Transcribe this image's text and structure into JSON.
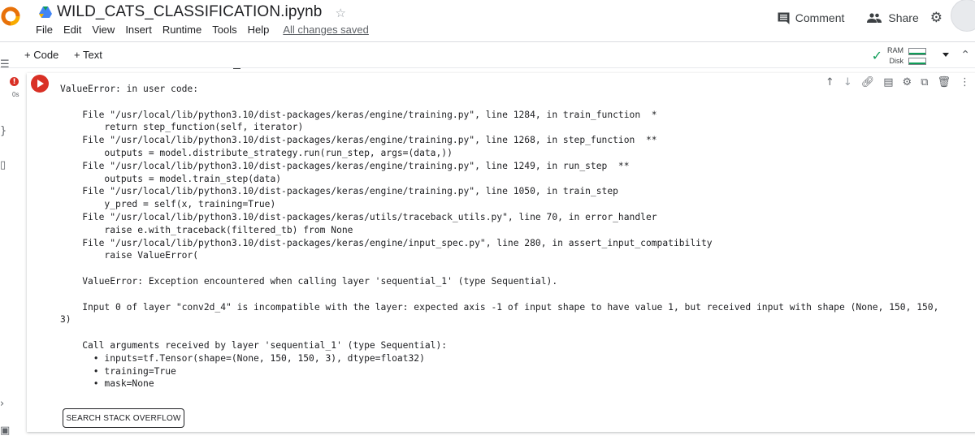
{
  "header": {
    "doc_title": "WILD_CATS_CLASSIFICATION.ipynb",
    "menu": [
      "File",
      "Edit",
      "View",
      "Insert",
      "Runtime",
      "Tools",
      "Help"
    ],
    "save_status": "All changes saved",
    "comment_label": "Comment",
    "share_label": "Share",
    "brand_color": "#f9ab00"
  },
  "toolbar": {
    "add_code_label": "+ Code",
    "add_text_label": "+ Text",
    "ram_label": "RAM",
    "disk_label": "Disk"
  },
  "cell": {
    "exec_time": "0s",
    "status": "error",
    "error_color": "#d93025",
    "output_lines": [
      "ValueError: in user code:",
      "",
      "    File \"/usr/local/lib/python3.10/dist-packages/keras/engine/training.py\", line 1284, in train_function  *",
      "        return step_function(self, iterator)",
      "    File \"/usr/local/lib/python3.10/dist-packages/keras/engine/training.py\", line 1268, in step_function  **",
      "        outputs = model.distribute_strategy.run(run_step, args=(data,))",
      "    File \"/usr/local/lib/python3.10/dist-packages/keras/engine/training.py\", line 1249, in run_step  **",
      "        outputs = model.train_step(data)",
      "    File \"/usr/local/lib/python3.10/dist-packages/keras/engine/training.py\", line 1050, in train_step",
      "        y_pred = self(x, training=True)",
      "    File \"/usr/local/lib/python3.10/dist-packages/keras/utils/traceback_utils.py\", line 70, in error_handler",
      "        raise e.with_traceback(filtered_tb) from None",
      "    File \"/usr/local/lib/python3.10/dist-packages/keras/engine/input_spec.py\", line 280, in assert_input_compatibility",
      "        raise ValueError(",
      "",
      "    ValueError: Exception encountered when calling layer 'sequential_1' (type Sequential).",
      "",
      "    Input 0 of layer \"conv2d_4\" is incompatible with the layer: expected axis -1 of input shape to have value 1, but received input with shape (None, 150, 150,",
      "3)",
      "",
      "    Call arguments received by layer 'sequential_1' (type Sequential):",
      "      • inputs=tf.Tensor(shape=(None, 150, 150, 3), dtype=float32)",
      "      • training=True",
      "      • mask=None"
    ],
    "search_button_label": "SEARCH STACK OVERFLOW"
  },
  "icons": {
    "logo": "colab-logo-icon",
    "drive": "drive-icon",
    "star": "star-icon",
    "comment": "comment-icon",
    "share": "people-icon",
    "settings": "gear-icon",
    "cell_tools": [
      "arrow-up-icon",
      "arrow-down-icon",
      "link-icon",
      "comment-icon",
      "gear-icon",
      "mirror-cell-icon",
      "delete-icon",
      "more-vert-icon"
    ]
  }
}
